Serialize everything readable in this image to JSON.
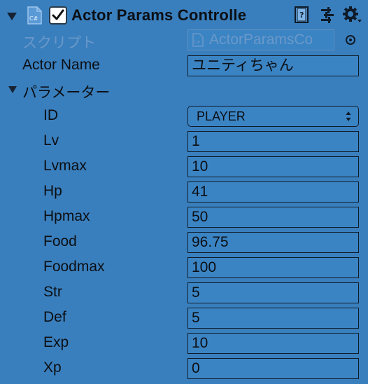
{
  "header": {
    "title": "Actor Params Controlle",
    "enabled": true
  },
  "script_row": {
    "label": "スクリプト",
    "value": "ActorParamsCo"
  },
  "actor_name": {
    "label": "Actor Name",
    "value": "ユニティちゃん"
  },
  "params_section": {
    "label": "パラメーター"
  },
  "id_field": {
    "label": "ID",
    "value": "PLAYER"
  },
  "fields": [
    {
      "label": "Lv",
      "value": "1"
    },
    {
      "label": "Lvmax",
      "value": "10"
    },
    {
      "label": "Hp",
      "value": "41"
    },
    {
      "label": "Hpmax",
      "value": "50"
    },
    {
      "label": "Food",
      "value": "96.75"
    },
    {
      "label": "Foodmax",
      "value": "100"
    },
    {
      "label": "Str",
      "value": "5"
    },
    {
      "label": "Def",
      "value": "5"
    },
    {
      "label": "Exp",
      "value": "10"
    },
    {
      "label": "Xp",
      "value": "0"
    }
  ],
  "colors": {
    "background": "#3a7fbd",
    "field_bg": "#3b84c4",
    "border": "#0e1b29",
    "dim_text": "#6a98c9"
  },
  "icons": [
    "foldout-arrow-icon",
    "cs-script-icon",
    "checkbox-check-icon",
    "help-book-icon",
    "preset-sliders-icon",
    "gear-icon",
    "object-picker-icon",
    "popup-updown-icon"
  ]
}
